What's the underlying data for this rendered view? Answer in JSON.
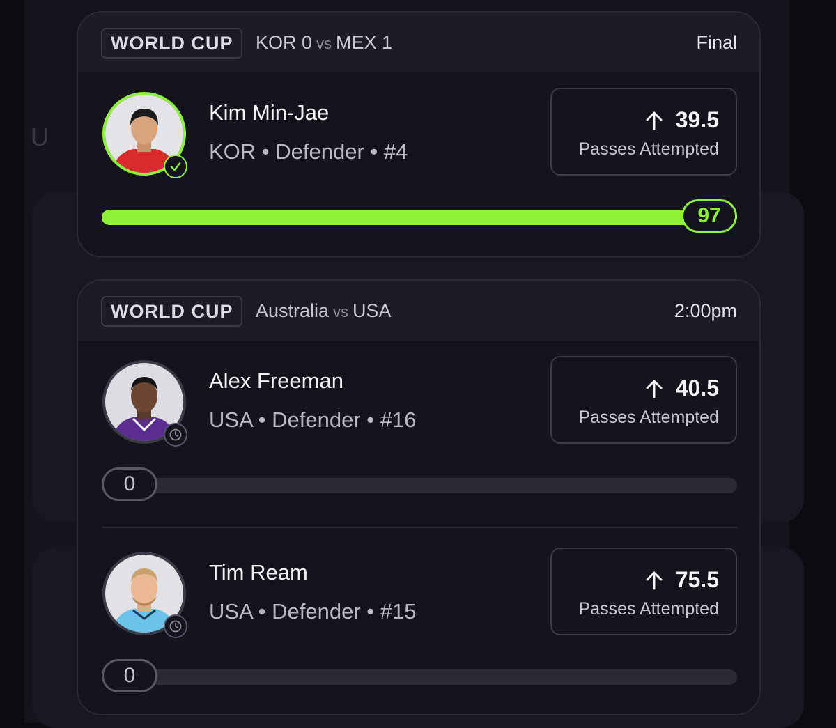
{
  "colors": {
    "accent": "#8ef23b",
    "background": "#14141d",
    "header": "#1c1c27"
  },
  "ghost_letter": "U",
  "games": [
    {
      "league": "WORLD CUP",
      "matchup": {
        "home": "KOR 0",
        "vs": "vs",
        "away": "MEX 1"
      },
      "status": "Final",
      "players": [
        {
          "name": "Kim Min-Jae",
          "info": "KOR • Defender • #4",
          "line": "39.5",
          "direction_icon": "arrow-up-icon",
          "stat": "Passes Attempted",
          "progress_value": "97",
          "progress_fraction": 1.0,
          "status_icon": "check-icon"
        }
      ]
    },
    {
      "league": "WORLD CUP",
      "matchup": {
        "home": "Australia",
        "vs": "vs",
        "away": "USA"
      },
      "status": "2:00pm",
      "players": [
        {
          "name": "Alex Freeman",
          "info": "USA • Defender • #16",
          "line": "40.5",
          "direction_icon": "arrow-up-icon",
          "stat": "Passes Attempted",
          "progress_value": "0",
          "progress_fraction": 0,
          "status_icon": "clock-icon"
        },
        {
          "name": "Tim Ream",
          "info": "USA • Defender • #15",
          "line": "75.5",
          "direction_icon": "arrow-up-icon",
          "stat": "Passes Attempted",
          "progress_value": "0",
          "progress_fraction": 0,
          "status_icon": "clock-icon"
        }
      ]
    }
  ]
}
